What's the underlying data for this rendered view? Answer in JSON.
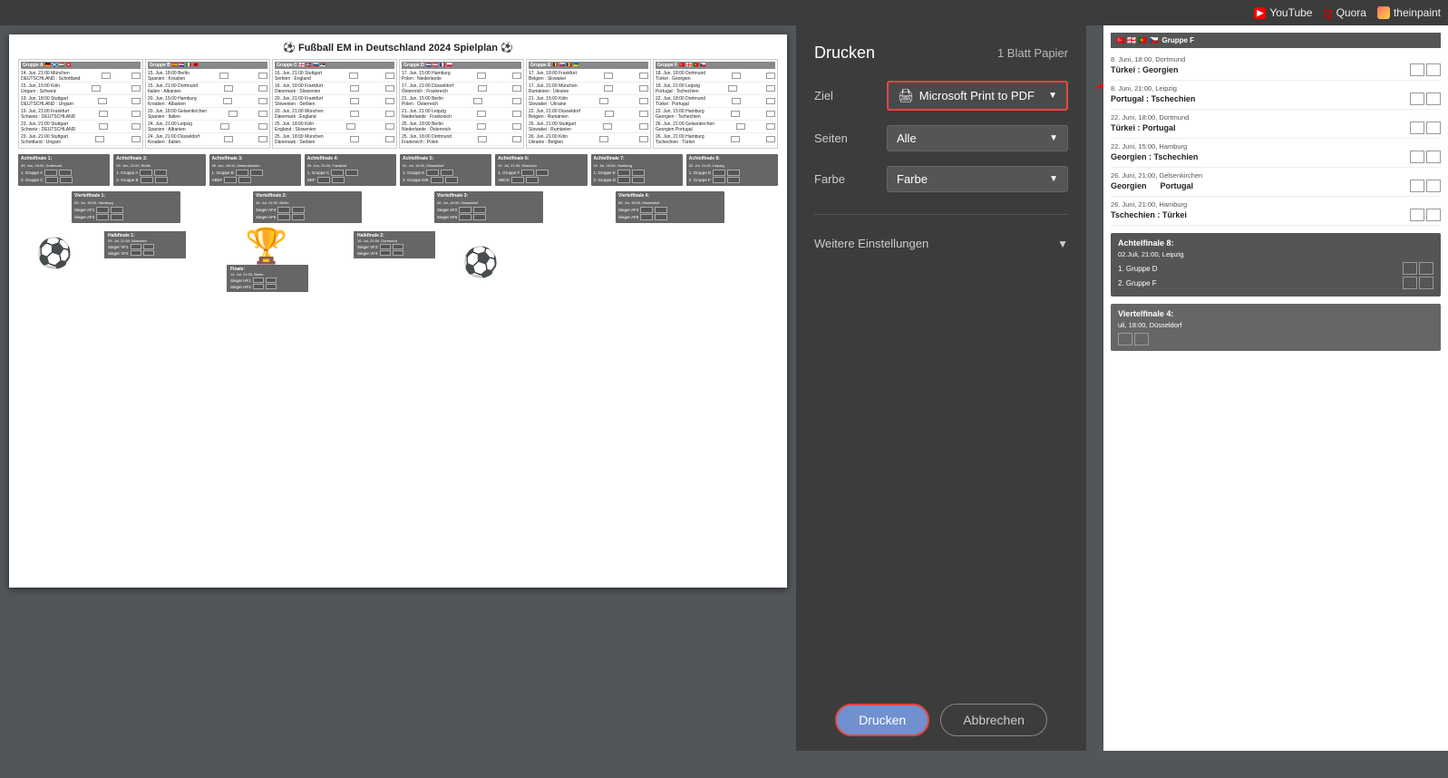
{
  "browser": {
    "bookmarks": [
      {
        "id": "youtube",
        "label": "YouTube",
        "icon": "youtube-icon"
      },
      {
        "id": "quora",
        "label": "Quora",
        "icon": "quora-icon"
      },
      {
        "id": "theinpaint",
        "label": "theinpaint",
        "icon": "theinpaint-icon"
      }
    ]
  },
  "print_panel": {
    "title": "Drucken",
    "pages_label": "1 Blatt Papier",
    "ziel_label": "Ziel",
    "ziel_value": "Microsoft Print to PDF",
    "seiten_label": "Seiten",
    "seiten_value": "Alle",
    "farbe_label": "Farbe",
    "farbe_value": "Farbe",
    "weitere_label": "Weitere Einstellungen",
    "btn_drucken": "Drucken",
    "btn_abbrechen": "Abbrechen"
  },
  "document": {
    "title": "⚽ Fußball EM in Deutschland 2024 Spielplan ⚽",
    "groups": [
      {
        "name": "Gruppe A",
        "flags": "🇩🇪 🏴󠁧󠁢󠁳󠁣󠁴󠁿 🇭🇺 🇨🇭",
        "matches": [
          "14. Jun, 21:00 München\nDEUTSCHLAND : Schottland",
          "15. Jun, 15:00 Köln\nUngarn : Schweiz",
          "19. Jun, 18:00 Stuttgart\nDEUTSCHLAND : Ungarn",
          "19. Jun, 21:00 Frankfurt\nSchweiz : DEUTSCHLAND",
          "23. Jun, 21:00 Stuttgart\nSchweiz : DEUTSCHLAND",
          "23. Jun, 21:00 Stuttgart\nSchottland : Ungarn"
        ]
      },
      {
        "name": "Gruppe B",
        "flags": "🇪🇸 🇭🇷 🇮🇹 🇦🇱",
        "matches": [
          "15. Jun, 18:00 Berlin\nSpanien : Kroatien",
          "15. Jun, 21:00 Dortmund\nItalien : Albanien",
          "20. Jun, 15:00 Hamburg\nKroatien : Albanien",
          "20. Jun, 18:00 Gelsenkirchen\nSpanien : Italien",
          "24. Jun, 21:00 Leipzig\nSpanien : Albanien",
          "24. Jun, 21:00 Düsseldorf\nKroatien : Italien"
        ]
      },
      {
        "name": "Gruppe C",
        "flags": "🏴󠁧󠁢󠁥󠁮󠁧󠁿 🇩🇰 🇸🇮 🇷🇸",
        "matches": [
          "16. Jun, 21:00 Stuttgart\nSerbien : England",
          "16. Jun, 18:00 Frankfurt\nDänemark : Slowenien",
          "20. Jun, 21:00 Frankfurt\nSlowenien : Serbien",
          "20. Jun, 21:00 München\nDänemark : England",
          "25. Jun, 18:00 Köln\nEngland : Slowenien",
          "25. Jun, 18:00 München\nDänemark : Serbien"
        ]
      },
      {
        "name": "Gruppe D",
        "flags": "🇳🇱 🇦🇹 🇫🇷 🇵🇱",
        "matches": [
          "17. Jun, 15:00 Hamburg\nPolen : Niederlande",
          "17. Jun, 21:00 Düsseldorf\nÖsterreich : Frankreich",
          "21. Jun, 15:00 Berlin\nPolen : Österreich",
          "21. Jun, 21:00 Leipzig\nNiederlande : Frankreich",
          "25. Jun, 18:00 Berlin\nNiederlande : Österreich",
          "25. Jun, 18:00 Dortmund\nFrankreich : Polen"
        ]
      },
      {
        "name": "Gruppe E",
        "flags": "🇧🇪 🇸🇰 🇷🇴 🇺🇦",
        "matches": [
          "17. Jun, 18:00 Frankfurt\nBelgien : Slowakei",
          "17. Jun, 21:00 München\nRumänien : Ukraine",
          "21. Jun, 15:00 Köln\nSlowakei : Ukraine",
          "22. Jun, 21:00 Düsseldorf\nBelgien : Rumänien",
          "26. Jun, 21:00 Stuttgart\nSlowakei : Rumänien",
          "26. Jun, 21:00 Köln\nUkraine : Belgien"
        ]
      },
      {
        "name": "Gruppe F",
        "flags": "🇹🇷 🇬🇪 🇵🇹 🇨🇿",
        "matches": [
          "18. Jun, 18:00 Dortmund\nTürkei : Georgien",
          "18. Jun, 21:00 Leipzig\nPortugal : Tschechien",
          "22. Jun, 18:00 Dortmund\nTürkei : Portugal",
          "22. Jun, 15:00 Hamburg\nGeorgien : Tschechien",
          "26. Jun, 21:00 Gelsenkirchen\nGeorgien   Portugal",
          "26. Jun, 21:00 Hamburg\nTschechien : Türkei"
        ]
      }
    ]
  },
  "right_panel": {
    "gruppe_f_title": "Gruppe F",
    "gruppe_f_flags": "🇹🇷 🇬🇪 🇵🇹 🇨🇿",
    "matches": [
      {
        "date": "8. Juni, 18:00, Dortmund",
        "teams": "Türkei : Georgien"
      },
      {
        "date": "8. Juni, 21:00, Leipzig",
        "teams": "Portugal : Tschechien"
      },
      {
        "date": "22. Juni, 18:00, Dortmund",
        "teams": "Türkei : Portugal"
      },
      {
        "date": "22. Juni, 15:00, Hamburg",
        "teams": "Georgien : Tschechien"
      },
      {
        "date": "26. Juni, 21:00, Gelsenkirchen",
        "teams_left": "Georgien",
        "teams_right": "Portugal"
      },
      {
        "date": "26. Juni, 21:00, Hamburg",
        "teams": "Tschechien : Türkei"
      }
    ],
    "achtelfinale8": {
      "title": "Achtelfinale 8:",
      "date": "02.Juli, 21:00, Leipzig",
      "team1": "1. Gruppe D",
      "team2": "2. Gruppe F"
    },
    "viertelfinale4": {
      "title": "Viertelfinale 4:",
      "date": "uli, 18:00, Düsseldorf"
    }
  }
}
